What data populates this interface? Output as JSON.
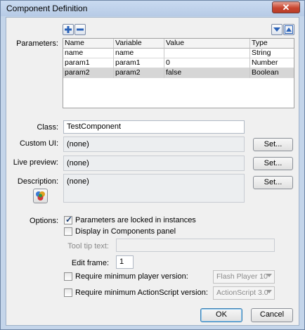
{
  "title": "Component Definition",
  "close_label": "✕",
  "params": {
    "label": "Parameters:",
    "columns": [
      "Name",
      "Variable",
      "Value",
      "Type"
    ],
    "rows": [
      [
        "name",
        "name",
        "",
        "String"
      ],
      [
        "param1",
        "param1",
        "0",
        "Number"
      ],
      [
        "param2",
        "param2",
        "false",
        "Boolean"
      ]
    ],
    "selected_row": 2,
    "add_icon": "plus-icon",
    "remove_icon": "minus-icon",
    "move_down_icon": "arrow-down-icon",
    "move_up_icon": "arrow-up-icon"
  },
  "class": {
    "label": "Class:",
    "value": "TestComponent"
  },
  "custom_ui": {
    "label": "Custom UI:",
    "value": "(none)",
    "button": "Set..."
  },
  "live_preview": {
    "label": "Live preview:",
    "value": "(none)",
    "button": "Set..."
  },
  "description": {
    "label": "Description:",
    "value": "(none)",
    "button": "Set...",
    "icon": "component-icon"
  },
  "options": {
    "label": "Options:",
    "locked": {
      "label": "Parameters are locked in instances",
      "checked": true
    },
    "display": {
      "label": "Display in Components panel",
      "checked": false
    },
    "tooltip_label": "Tool tip text:",
    "tooltip_value": "",
    "edit_frame_label": "Edit frame:",
    "edit_frame_value": "1",
    "min_player": {
      "label": "Require minimum player version:",
      "checked": false,
      "select": "Flash Player 10"
    },
    "min_as": {
      "label": "Require minimum ActionScript version:",
      "checked": false,
      "select": "ActionScript 3.0"
    }
  },
  "ok_label": "OK",
  "cancel_label": "Cancel",
  "colors": {
    "title_bg": "#c4d5ea",
    "close_red": "#c8452f",
    "selected_row": "#d6d6d6"
  }
}
